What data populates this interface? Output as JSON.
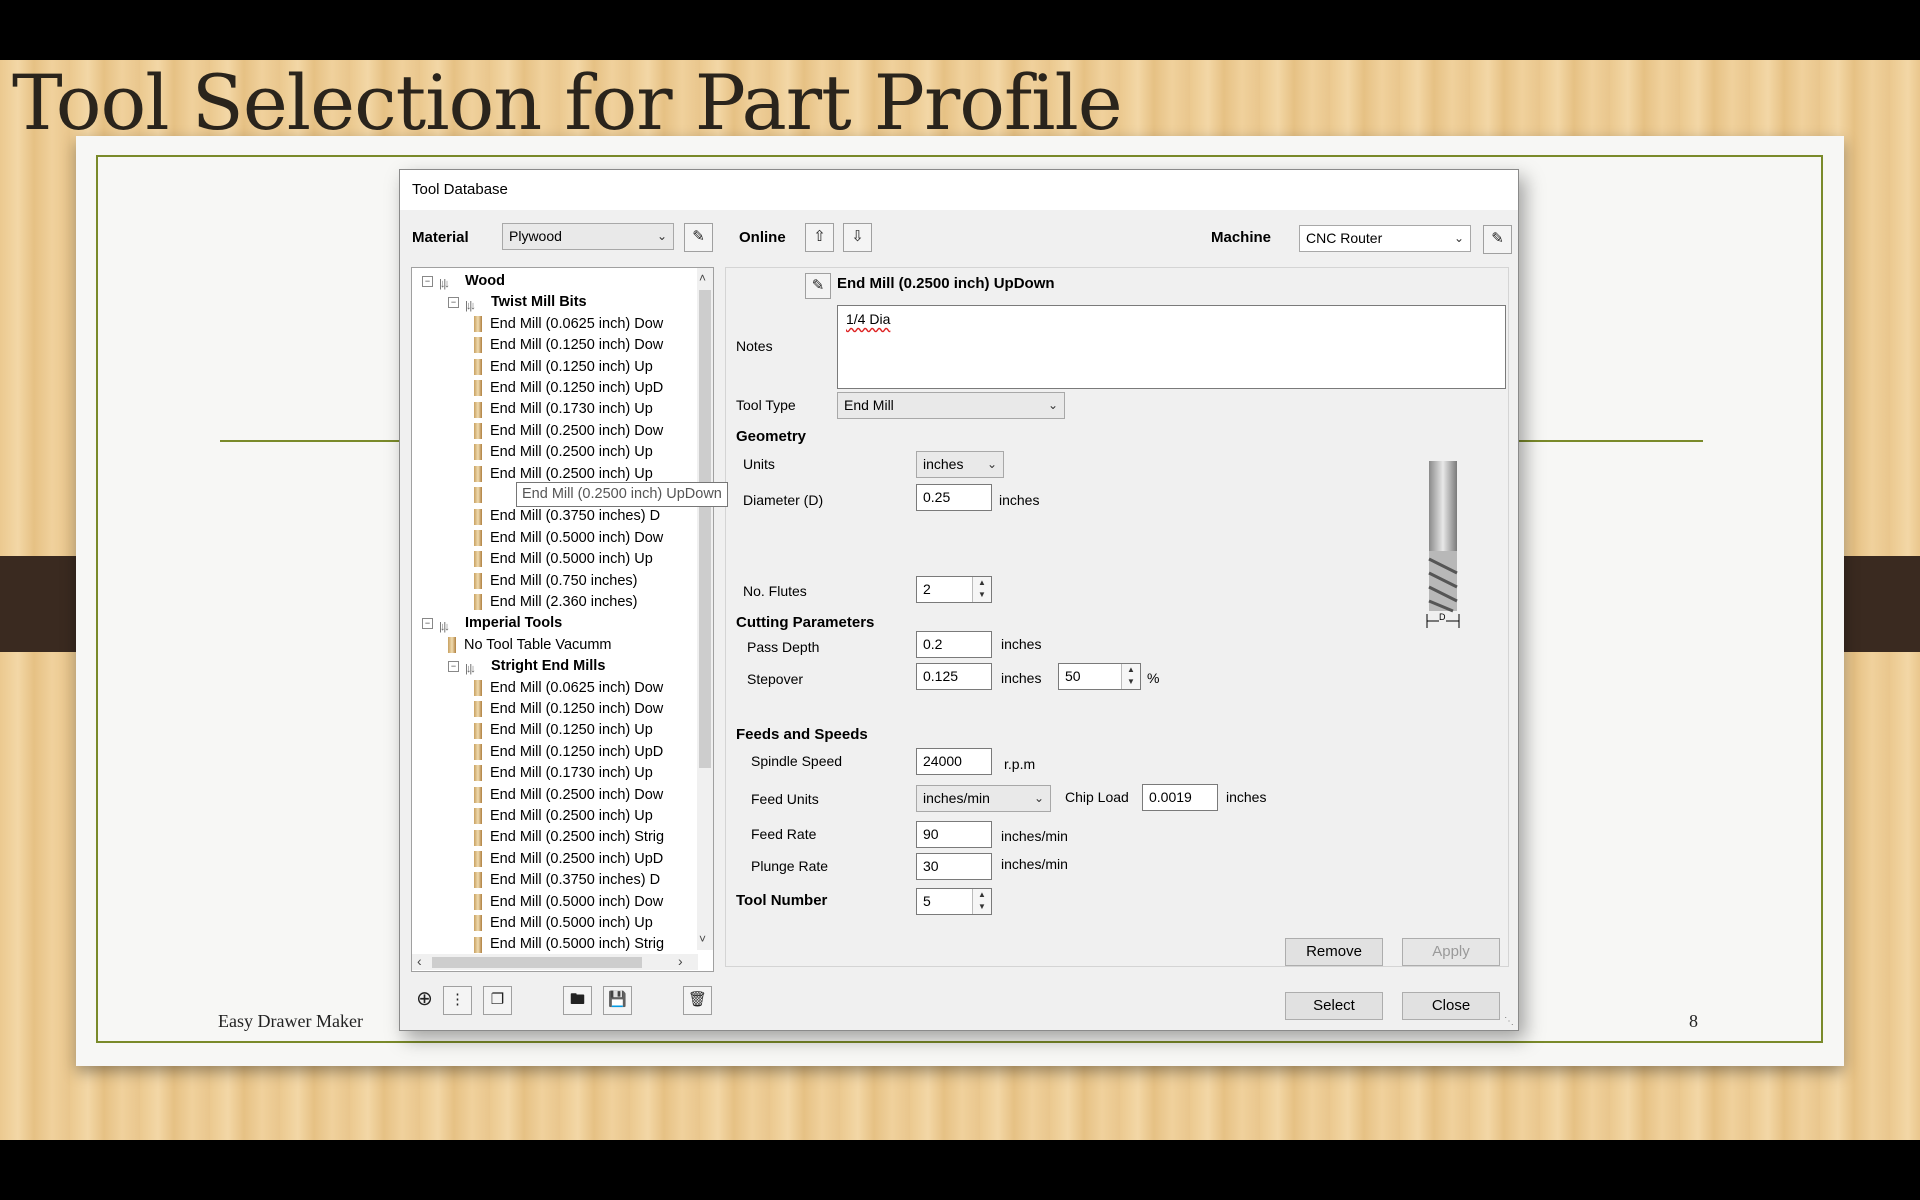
{
  "slide": {
    "title": "Tool Selection for Part Profile",
    "footer_left": "Easy Drawer Maker",
    "page_number": "8"
  },
  "dialog": {
    "title": "Tool Database",
    "material_label": "Material",
    "material_value": "Plywood",
    "online_label": "Online",
    "machine_label": "Machine",
    "machine_value": "CNC Router"
  },
  "tree": {
    "items": [
      {
        "label": "Wood",
        "level": 0,
        "kind": "group"
      },
      {
        "label": "Twist Mill Bits",
        "level": 1,
        "kind": "group"
      },
      {
        "label": "End Mill (0.0625 inch) Dow",
        "level": 2,
        "kind": "tool"
      },
      {
        "label": "End Mill (0.1250 inch) Dow",
        "level": 2,
        "kind": "tool"
      },
      {
        "label": "End Mill (0.1250 inch) Up",
        "level": 2,
        "kind": "tool"
      },
      {
        "label": "End Mill (0.1250 inch) UpD",
        "level": 2,
        "kind": "tool"
      },
      {
        "label": "End Mill (0.1730 inch) Up",
        "level": 2,
        "kind": "tool"
      },
      {
        "label": "End Mill (0.2500 inch) Dow",
        "level": 2,
        "kind": "tool"
      },
      {
        "label": "End Mill (0.2500 inch) Up",
        "level": 2,
        "kind": "tool"
      },
      {
        "label": "End Mill (0.2500 inch) Up",
        "level": 2,
        "kind": "tool"
      },
      {
        "label": "",
        "level": 2,
        "kind": "tool"
      },
      {
        "label": "End Mill (0.3750 inches) D",
        "level": 2,
        "kind": "tool"
      },
      {
        "label": "End Mill (0.5000 inch) Dow",
        "level": 2,
        "kind": "tool"
      },
      {
        "label": "End Mill (0.5000 inch) Up",
        "level": 2,
        "kind": "tool"
      },
      {
        "label": "End Mill (0.750 inches)",
        "level": 2,
        "kind": "tool"
      },
      {
        "label": "End Mill (2.360 inches)",
        "level": 2,
        "kind": "tool"
      },
      {
        "label": "Imperial Tools",
        "level": 0,
        "kind": "group"
      },
      {
        "label": "No Tool Table Vacumm",
        "level": 1,
        "kind": "tool"
      },
      {
        "label": "Stright End Mills",
        "level": 1,
        "kind": "group"
      },
      {
        "label": "End Mill (0.0625 inch) Dow",
        "level": 2,
        "kind": "tool"
      },
      {
        "label": "End Mill (0.1250 inch) Dow",
        "level": 2,
        "kind": "tool"
      },
      {
        "label": "End Mill (0.1250 inch) Up",
        "level": 2,
        "kind": "tool"
      },
      {
        "label": "End Mill (0.1250 inch) UpD",
        "level": 2,
        "kind": "tool"
      },
      {
        "label": "End Mill (0.1730 inch) Up",
        "level": 2,
        "kind": "tool"
      },
      {
        "label": "End Mill (0.2500 inch) Dow",
        "level": 2,
        "kind": "tool"
      },
      {
        "label": "End Mill (0.2500 inch) Up",
        "level": 2,
        "kind": "tool"
      },
      {
        "label": "End Mill (0.2500 inch) Strig",
        "level": 2,
        "kind": "tool"
      },
      {
        "label": "End Mill (0.2500 inch) UpD",
        "level": 2,
        "kind": "tool"
      },
      {
        "label": "End Mill (0.3750 inches) D",
        "level": 2,
        "kind": "tool"
      },
      {
        "label": "End Mill (0.5000 inch) Dow",
        "level": 2,
        "kind": "tool"
      },
      {
        "label": "End Mill (0.5000 inch) Up",
        "level": 2,
        "kind": "tool"
      },
      {
        "label": "End Mill (0.5000 inch) Strig",
        "level": 2,
        "kind": "tool"
      }
    ],
    "tooltip": "End Mill (0.2500 inch) UpDown"
  },
  "tool": {
    "name": "End Mill (0.2500 inch) UpDown",
    "notes_label": "Notes",
    "notes": "1/4 Dia",
    "tool_type_label": "Tool Type",
    "tool_type": "End Mill",
    "geometry_label": "Geometry",
    "units_label": "Units",
    "units": "inches",
    "diameter_label": "Diameter (D)",
    "diameter": "0.25",
    "diameter_unit": "inches",
    "flutes_label": "No. Flutes",
    "flutes": "2",
    "cutting_label": "Cutting Parameters",
    "pass_depth_label": "Pass Depth",
    "pass_depth": "0.2",
    "pass_depth_unit": "inches",
    "stepover_label": "Stepover",
    "stepover": "0.125",
    "stepover_unit": "inches",
    "stepover_percent": "50",
    "percent_sign": "%",
    "feeds_label": "Feeds and Speeds",
    "spindle_label": "Spindle Speed",
    "spindle": "24000",
    "spindle_unit": "r.p.m",
    "feed_units_label": "Feed Units",
    "feed_units": "inches/min",
    "chip_load_label": "Chip Load",
    "chip_load": "0.0019",
    "chip_load_unit": "inches",
    "feed_rate_label": "Feed Rate",
    "feed_rate": "90",
    "feed_rate_unit": "inches/min",
    "plunge_rate_label": "Plunge Rate",
    "plunge_rate": "30",
    "plunge_rate_unit": "inches/min",
    "tool_number_label": "Tool Number",
    "tool_number": "5",
    "diagram_label": "D"
  },
  "buttons": {
    "remove": "Remove",
    "apply": "Apply",
    "select": "Select",
    "close": "Close"
  }
}
